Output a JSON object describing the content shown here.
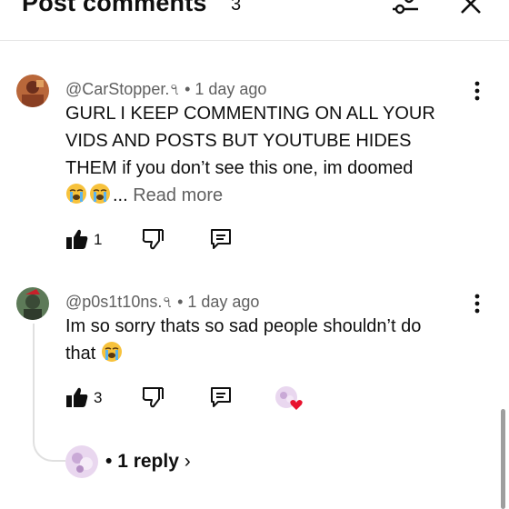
{
  "header": {
    "title": "Post comments",
    "count": "3"
  },
  "comments": [
    {
      "author": "@CarStopper.৭",
      "time": "1 day ago",
      "lines": [
        "GURL I KEEP COMMENTING ON ALL YOUR",
        "VIDS AND POSTS BUT YOUTUBE HIDES",
        "THEM if you don’t see this one, im doomed"
      ],
      "ellipsis": "...",
      "read_more": "Read more",
      "likes": "1"
    },
    {
      "author": "@p0s1t10ns.৭",
      "time": "1 day ago",
      "lines": [
        "Im so sorry thats so sad people shouldn’t do",
        "that"
      ],
      "likes": "3",
      "replies": "1 reply"
    }
  ],
  "icons": {
    "filter": "filter-sliders-icon",
    "close": "close-icon",
    "more": "more-vertical-icon",
    "like": "thumbs-up-icon",
    "dislike": "thumbs-down-icon",
    "reply": "reply-comment-icon",
    "heart": "creator-heart-icon",
    "crying": "loudly-crying-face-emoji",
    "chevron": "chevron-right-icon"
  },
  "colors": {
    "text": "#0f0f0f",
    "secondary": "#606060",
    "heart": "#e8112d"
  }
}
